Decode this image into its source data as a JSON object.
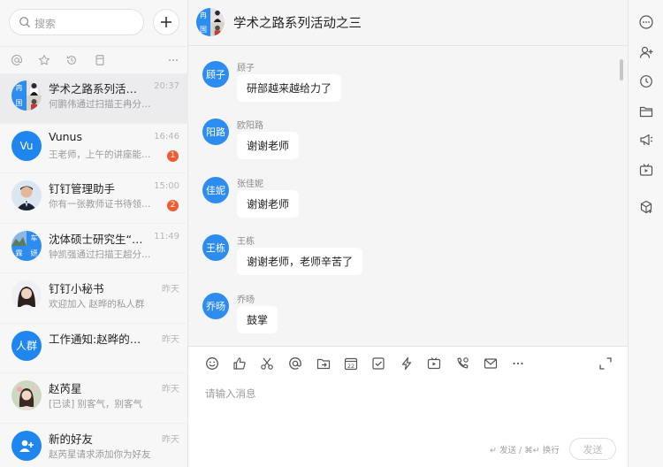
{
  "search": {
    "placeholder": "搜索"
  },
  "conversations": [
    {
      "name": "学术之路系列活动…",
      "time": "20:37",
      "preview": "何鹏伟通过扫描王冉分…",
      "badge": ""
    },
    {
      "name": "Vunus",
      "avatar_text": "Vu",
      "time": "16:46",
      "preview": "王老师，上午的讲座能…",
      "badge": "1"
    },
    {
      "name": "钉钉管理助手",
      "time": "15:00",
      "preview": "你有一张教师证书待领…",
      "badge": "2"
    },
    {
      "name": "沈体硕士研究生“学…",
      "time": "11:49",
      "preview": "钟凯强通过扫描王超分…",
      "badge": ""
    },
    {
      "name": "钉钉小秘书",
      "time": "昨天",
      "preview": "欢迎加入 赵晔的私人群",
      "badge": ""
    },
    {
      "name": "工作通知:赵晔的私…",
      "avatar_text": "人群",
      "time": "昨天",
      "preview": "",
      "badge": ""
    },
    {
      "name": "赵芮星",
      "time": "昨天",
      "preview": "[已读] 别客气，别客气",
      "badge": ""
    },
    {
      "name": "新的好友",
      "time": "昨天",
      "preview": "赵芮星请求添加你为好友",
      "badge": ""
    }
  ],
  "group_avatar_chars": [
    "冉",
    "国"
  ],
  "group_avatar_chars_2": [
    "车",
    "霖",
    "妍"
  ],
  "chat": {
    "title": "学术之路系列活动之三",
    "messages": [
      {
        "sender": "顾子",
        "avatar": "顾子",
        "text": "研部越来越给力了"
      },
      {
        "sender": "欧阳路",
        "avatar": "阳路",
        "text": "谢谢老师"
      },
      {
        "sender": "张佳妮",
        "avatar": "佳妮",
        "text": "谢谢老师"
      },
      {
        "sender": "王栋",
        "avatar": "王栋",
        "text": "谢谢老师，老师辛苦了"
      },
      {
        "sender": "乔旸",
        "avatar": "乔旸",
        "text": "鼓掌"
      }
    ],
    "input_placeholder": "请输入消息",
    "shortcut_hint": "↵ 发送 / ⌘↵ 换行",
    "send_label": "发送",
    "calendar_day": "22"
  },
  "colors": {
    "accent": "#1f86f0",
    "badge": "#f25b32",
    "bubble": "#ffffff"
  }
}
